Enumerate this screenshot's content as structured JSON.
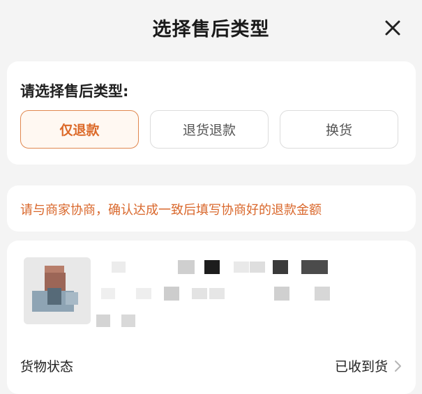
{
  "header": {
    "title": "选择售后类型"
  },
  "type_section": {
    "label": "请选择售后类型:",
    "options": [
      "仅退款",
      "退货退款",
      "换货"
    ],
    "selected": "仅退款"
  },
  "notice": {
    "text": "请与商家协商，确认达成一致后填写协商好的退款金额"
  },
  "product": {
    "status_label": "货物状态",
    "status_value": "已收到货"
  },
  "colors": {
    "accent": "#dc6a2a",
    "accent_border": "#e0874f",
    "background": "#f4f4f4",
    "card": "#ffffff"
  },
  "icons": {
    "close": "close-icon",
    "chevron": "chevron-right-icon"
  }
}
